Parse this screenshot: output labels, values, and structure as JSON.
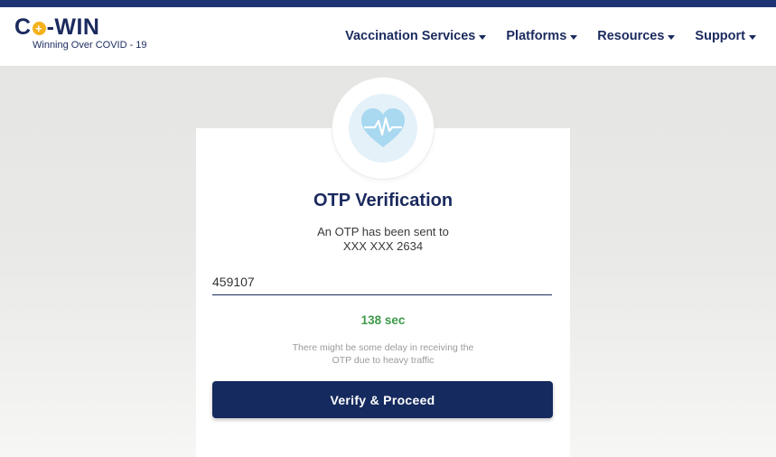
{
  "brand": {
    "logo_prefix": "C",
    "logo_plus": "+",
    "logo_suffix": "-WIN",
    "tagline": "Winning Over COVID - 19"
  },
  "nav": {
    "items": [
      {
        "label": "Vaccination Services",
        "icon": "chevron-down-icon"
      },
      {
        "label": "Platforms",
        "icon": "chevron-down-icon"
      },
      {
        "label": "Resources",
        "icon": "chevron-down-icon"
      },
      {
        "label": "Support",
        "icon": "chevron-down-icon"
      }
    ]
  },
  "otp": {
    "icon": "heart-pulse-icon",
    "title": "OTP Verification",
    "message_line1": "An OTP has been sent to",
    "message_line2": "XXX XXX 2634",
    "value": "459107",
    "timer": "138 sec",
    "note_line1": "There might be some delay in receiving the",
    "note_line2": "OTP due to heavy traffic",
    "button_label": "Verify & Proceed"
  },
  "colors": {
    "brand_navy": "#1b2a5e",
    "button_navy": "#152a5e",
    "timer_green": "#3d9a4a",
    "logo_yellow": "#f3b21c",
    "heart_blue": "#a9d8f1"
  }
}
